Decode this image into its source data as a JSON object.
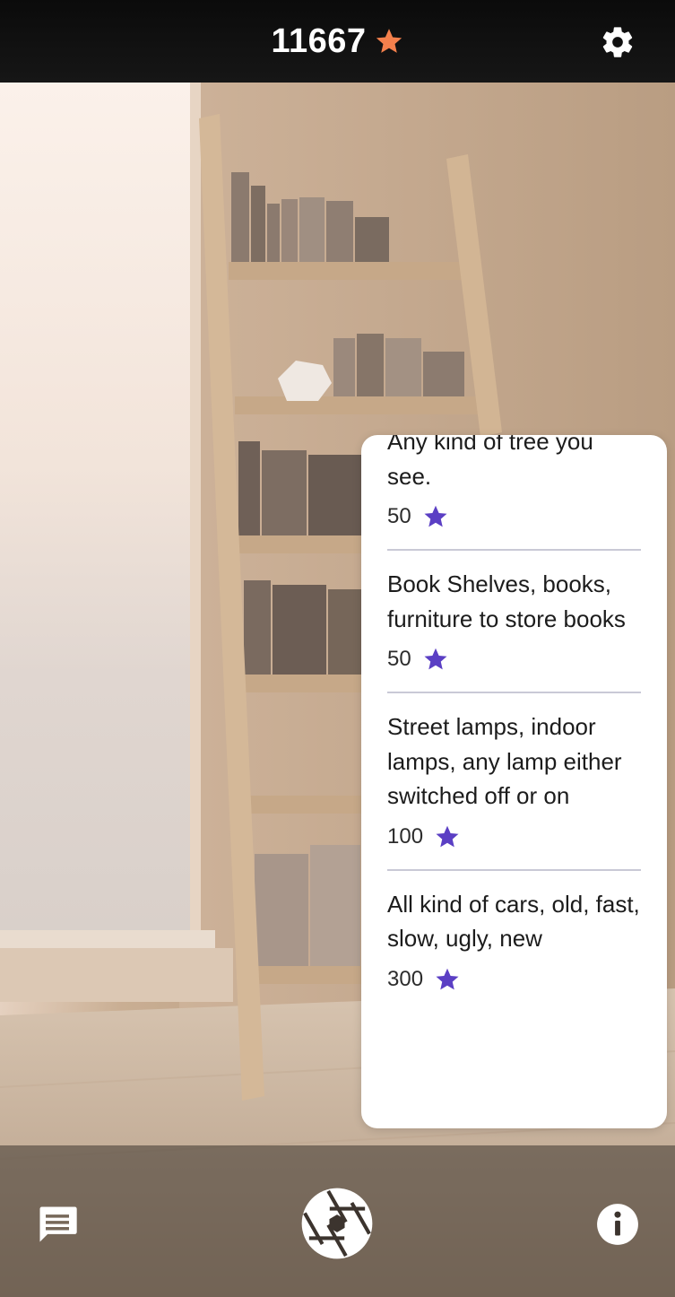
{
  "header": {
    "score": "11667",
    "score_icon": "star-icon",
    "settings_icon": "gear-icon",
    "score_star_color": "#f4804c"
  },
  "objects_list": {
    "star_color": "#5b3fc4",
    "items": [
      {
        "title": "Any kind of tree you see.",
        "points": "50"
      },
      {
        "title": "Book Shelves, books, furniture to store books",
        "points": "50"
      },
      {
        "title": "Street lamps, indoor lamps, any lamp either switched off or on",
        "points": "100"
      },
      {
        "title": "All kind of cars, old, fast, slow, ugly, new",
        "points": "300"
      }
    ]
  },
  "footer": {
    "left_icon": "chat-icon",
    "center_icon": "camera-shutter-icon",
    "right_icon": "info-icon"
  }
}
